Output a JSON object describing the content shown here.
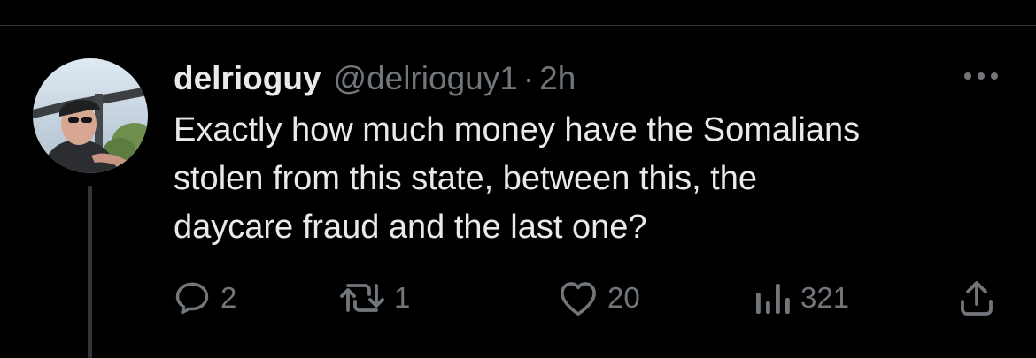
{
  "tweet": {
    "display_name": "delrioguy",
    "handle": "@delrioguy1",
    "separator": "·",
    "time": "2h",
    "text_lines": [
      "Exactly how much money have the Somalians",
      "stolen from this state, between this, the",
      "daycare fraud and the last one?"
    ]
  },
  "actions": {
    "reply_count": "2",
    "retweet_count": "1",
    "like_count": "20",
    "views_count": "321"
  },
  "icons": {
    "avatar": "user-avatar-photo",
    "more": "more-options-icon",
    "reply": "reply-icon",
    "retweet": "retweet-icon",
    "like": "heart-icon",
    "views": "views-bar-chart-icon",
    "share": "share-icon"
  },
  "colors": {
    "background": "#000000",
    "primary_text": "#e7e9ea",
    "secondary_text": "#71767b",
    "divider": "#2f3336"
  }
}
